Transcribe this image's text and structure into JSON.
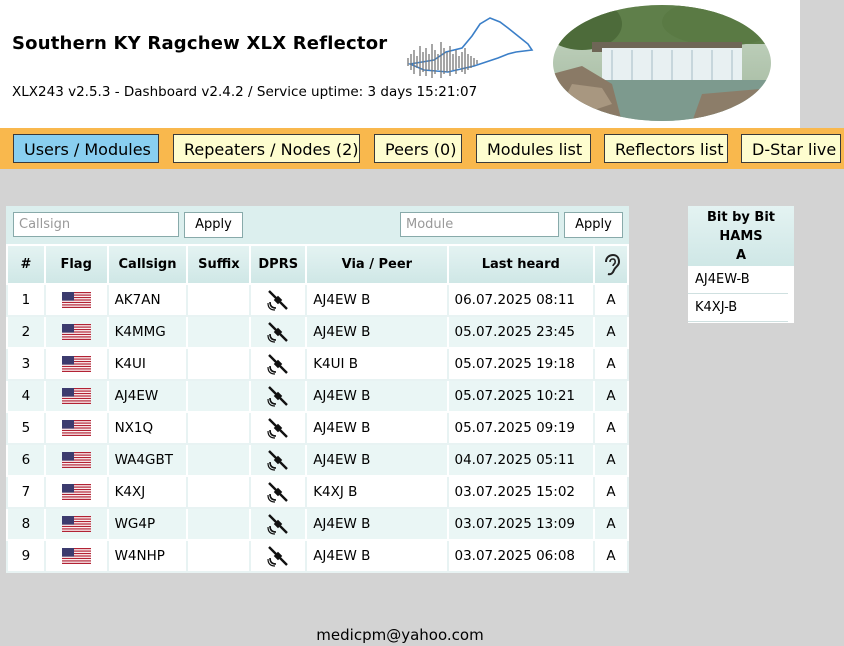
{
  "header": {
    "title": "Southern KY Ragchew XLX Reflector",
    "version_line": "XLX243 v2.5.3 - Dashboard v2.4.2   /  Service uptime: 3 days 15:21:07"
  },
  "nav": {
    "items": [
      {
        "label": "Users / Modules",
        "active": true
      },
      {
        "label": "Repeaters / Nodes (2)"
      },
      {
        "label": "Peers (0)"
      },
      {
        "label": "Modules list"
      },
      {
        "label": "Reflectors list"
      },
      {
        "label": "D-Star live"
      }
    ]
  },
  "filters": {
    "callsign_placeholder": "Callsign",
    "module_placeholder": "Module",
    "apply_label": "Apply"
  },
  "table": {
    "columns": [
      "#",
      "Flag",
      "Callsign",
      "Suffix",
      "DPRS",
      "Via / Peer",
      "Last heard",
      "ear-icon"
    ],
    "rows": [
      {
        "num": "1",
        "callsign": "AK7AN",
        "suffix": "",
        "via": "AJ4EW B",
        "heard": "06.07.2025 08:11",
        "module": "A"
      },
      {
        "num": "2",
        "callsign": "K4MMG",
        "suffix": "",
        "via": "AJ4EW B",
        "heard": "05.07.2025 23:45",
        "module": "A"
      },
      {
        "num": "3",
        "callsign": "K4UI",
        "suffix": "",
        "via": "K4UI B",
        "heard": "05.07.2025 19:18",
        "module": "A"
      },
      {
        "num": "4",
        "callsign": "AJ4EW",
        "suffix": "",
        "via": "AJ4EW B",
        "heard": "05.07.2025 10:21",
        "module": "A"
      },
      {
        "num": "5",
        "callsign": "NX1Q",
        "suffix": "",
        "via": "AJ4EW B",
        "heard": "05.07.2025 09:19",
        "module": "A"
      },
      {
        "num": "6",
        "callsign": "WA4GBT",
        "suffix": "",
        "via": "AJ4EW B",
        "heard": "04.07.2025 05:11",
        "module": "A"
      },
      {
        "num": "7",
        "callsign": "K4XJ",
        "suffix": "",
        "via": "K4XJ B",
        "heard": "03.07.2025 15:02",
        "module": "A"
      },
      {
        "num": "8",
        "callsign": "WG4P",
        "suffix": "",
        "via": "AJ4EW B",
        "heard": "03.07.2025 13:09",
        "module": "A"
      },
      {
        "num": "9",
        "callsign": "W4NHP",
        "suffix": "",
        "via": "AJ4EW B",
        "heard": "03.07.2025 06:08",
        "module": "A"
      }
    ]
  },
  "module_box": {
    "line1": "Bit by Bit",
    "line2": "HAMS",
    "line3": "A",
    "items": [
      "AJ4EW-B",
      "K4XJ-B"
    ]
  },
  "footer": {
    "email": "medicpm@yahoo.com"
  },
  "colors": {
    "nav_bar": "#f9b84d",
    "nav_button": "#fefdcf",
    "nav_active": "#89cff0",
    "page_bg": "#d3d3d3",
    "table_header": "#dcefee"
  }
}
